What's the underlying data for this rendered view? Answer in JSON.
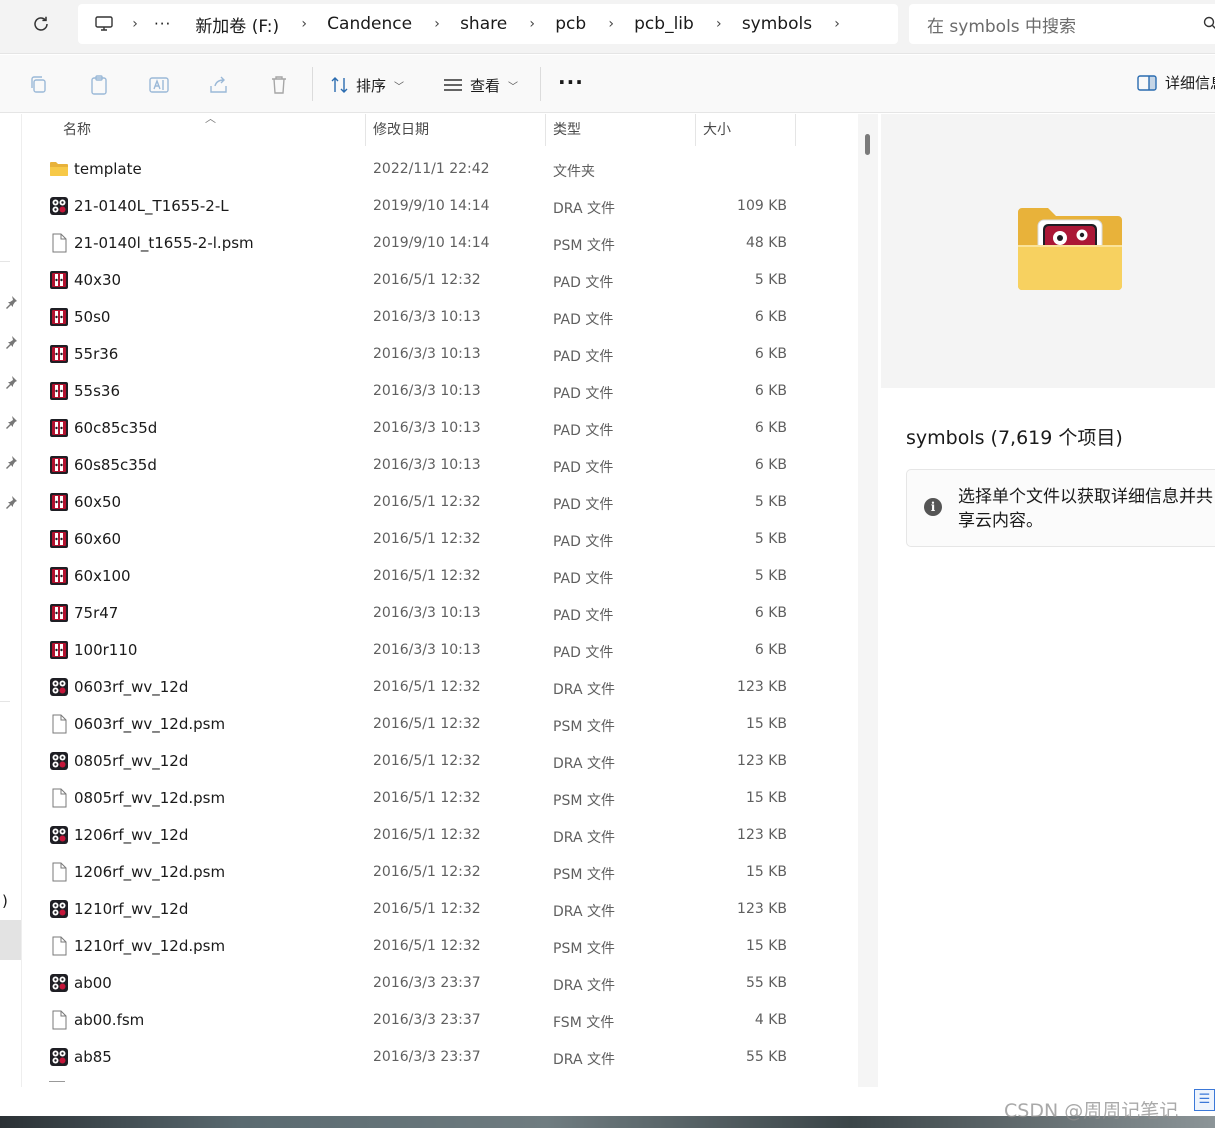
{
  "address": {
    "overflow": "···",
    "crumbs": [
      "新加卷 (F:)",
      "Candence",
      "share",
      "pcb",
      "pcb_lib",
      "symbols"
    ],
    "search_placeholder": "在 symbols 中搜索"
  },
  "toolbar": {
    "sort_label": "排序",
    "view_label": "查看",
    "more_label": "···",
    "details_label": "详细信息"
  },
  "columns": {
    "name": "名称",
    "modified": "修改日期",
    "type": "类型",
    "size": "大小"
  },
  "files": [
    {
      "icon": "folder-icon",
      "name": "template",
      "date": "2022/11/1 22:42",
      "type": "文件夹",
      "size": ""
    },
    {
      "icon": "dra-file-icon",
      "name": "21-0140L_T1655-2-L",
      "date": "2019/9/10 14:14",
      "type": "DRA 文件",
      "size": "109 KB"
    },
    {
      "icon": "generic-file-icon",
      "name": "21-0140l_t1655-2-l.psm",
      "date": "2019/9/10 14:14",
      "type": "PSM 文件",
      "size": "48 KB"
    },
    {
      "icon": "pad-file-icon",
      "name": "40x30",
      "date": "2016/5/1 12:32",
      "type": "PAD 文件",
      "size": "5 KB"
    },
    {
      "icon": "pad-file-icon",
      "name": "50s0",
      "date": "2016/3/3 10:13",
      "type": "PAD 文件",
      "size": "6 KB"
    },
    {
      "icon": "pad-file-icon",
      "name": "55r36",
      "date": "2016/3/3 10:13",
      "type": "PAD 文件",
      "size": "6 KB"
    },
    {
      "icon": "pad-file-icon",
      "name": "55s36",
      "date": "2016/3/3 10:13",
      "type": "PAD 文件",
      "size": "6 KB"
    },
    {
      "icon": "pad-file-icon",
      "name": "60c85c35d",
      "date": "2016/3/3 10:13",
      "type": "PAD 文件",
      "size": "6 KB"
    },
    {
      "icon": "pad-file-icon",
      "name": "60s85c35d",
      "date": "2016/3/3 10:13",
      "type": "PAD 文件",
      "size": "6 KB"
    },
    {
      "icon": "pad-file-icon",
      "name": "60x50",
      "date": "2016/5/1 12:32",
      "type": "PAD 文件",
      "size": "5 KB"
    },
    {
      "icon": "pad-file-icon",
      "name": "60x60",
      "date": "2016/5/1 12:32",
      "type": "PAD 文件",
      "size": "5 KB"
    },
    {
      "icon": "pad-file-icon",
      "name": "60x100",
      "date": "2016/5/1 12:32",
      "type": "PAD 文件",
      "size": "5 KB"
    },
    {
      "icon": "pad-file-icon",
      "name": "75r47",
      "date": "2016/3/3 10:13",
      "type": "PAD 文件",
      "size": "6 KB"
    },
    {
      "icon": "pad-file-icon",
      "name": "100r110",
      "date": "2016/3/3 10:13",
      "type": "PAD 文件",
      "size": "6 KB"
    },
    {
      "icon": "dra-file-icon",
      "name": "0603rf_wv_12d",
      "date": "2016/5/1 12:32",
      "type": "DRA 文件",
      "size": "123 KB"
    },
    {
      "icon": "generic-file-icon",
      "name": "0603rf_wv_12d.psm",
      "date": "2016/5/1 12:32",
      "type": "PSM 文件",
      "size": "15 KB"
    },
    {
      "icon": "dra-file-icon",
      "name": "0805rf_wv_12d",
      "date": "2016/5/1 12:32",
      "type": "DRA 文件",
      "size": "123 KB"
    },
    {
      "icon": "generic-file-icon",
      "name": "0805rf_wv_12d.psm",
      "date": "2016/5/1 12:32",
      "type": "PSM 文件",
      "size": "15 KB"
    },
    {
      "icon": "dra-file-icon",
      "name": "1206rf_wv_12d",
      "date": "2016/5/1 12:32",
      "type": "DRA 文件",
      "size": "123 KB"
    },
    {
      "icon": "generic-file-icon",
      "name": "1206rf_wv_12d.psm",
      "date": "2016/5/1 12:32",
      "type": "PSM 文件",
      "size": "15 KB"
    },
    {
      "icon": "dra-file-icon",
      "name": "1210rf_wv_12d",
      "date": "2016/5/1 12:32",
      "type": "DRA 文件",
      "size": "123 KB"
    },
    {
      "icon": "generic-file-icon",
      "name": "1210rf_wv_12d.psm",
      "date": "2016/5/1 12:32",
      "type": "PSM 文件",
      "size": "15 KB"
    },
    {
      "icon": "dra-file-icon",
      "name": "ab00",
      "date": "2016/3/3 23:37",
      "type": "DRA 文件",
      "size": "55 KB"
    },
    {
      "icon": "generic-file-icon",
      "name": "ab00.fsm",
      "date": "2016/3/3 23:37",
      "type": "FSM 文件",
      "size": "4 KB"
    },
    {
      "icon": "dra-file-icon",
      "name": "ab85",
      "date": "2016/3/3 23:37",
      "type": "DRA 文件",
      "size": "55 KB"
    }
  ],
  "details": {
    "title": "symbols (7,619 个项目)",
    "info_text": "选择单个文件以获取详细信息并共享云内容。"
  },
  "nav": {
    "paren": ")"
  },
  "watermark": "CSDN @周周记笔记",
  "colors": {
    "folder_yellow": "#f7c948",
    "pad_icon_red": "#b3122f",
    "dra_icon_dark": "#1e1e24"
  }
}
